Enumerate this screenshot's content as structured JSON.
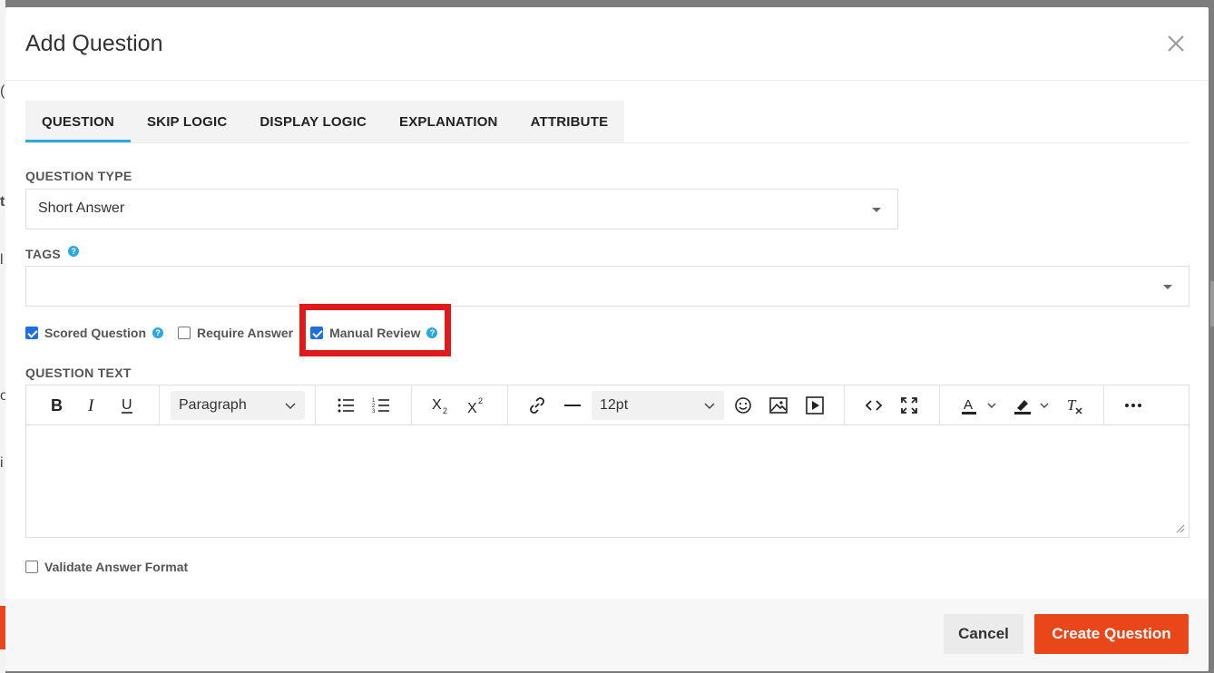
{
  "background": {
    "fragments": [
      "(U",
      "t",
      "l",
      "o",
      "i"
    ]
  },
  "modal": {
    "title": "Add Question",
    "tabs": [
      {
        "label": "QUESTION",
        "active": true
      },
      {
        "label": "SKIP LOGIC",
        "active": false
      },
      {
        "label": "DISPLAY LOGIC",
        "active": false
      },
      {
        "label": "EXPLANATION",
        "active": false
      },
      {
        "label": "ATTRIBUTE",
        "active": false
      }
    ],
    "question_type": {
      "label": "QUESTION TYPE",
      "value": "Short Answer"
    },
    "tags": {
      "label": "TAGS",
      "value": ""
    },
    "options": [
      {
        "label": "Scored Question",
        "checked": true,
        "help": true
      },
      {
        "label": "Require Answer",
        "checked": false,
        "help": false
      },
      {
        "label": "Manual Review",
        "checked": true,
        "help": true
      }
    ],
    "question_text": {
      "label": "QUESTION TEXT",
      "block_format": "Paragraph",
      "font_size": "12pt",
      "content": ""
    },
    "validate_answer_format": {
      "label": "Validate Answer Format",
      "checked": false
    },
    "buttons": {
      "cancel": "Cancel",
      "create": "Create Question"
    }
  },
  "colors": {
    "accent_blue": "#2aa8df",
    "checkbox_blue": "#1f6fe0",
    "primary_orange": "#e9461a",
    "highlight_red": "#e0191d"
  },
  "icons": [
    "close-icon",
    "bold-icon",
    "italic-icon",
    "underline-icon",
    "bullet-list-icon",
    "numbered-list-icon",
    "subscript-icon",
    "superscript-icon",
    "link-icon",
    "horizontal-rule-icon",
    "emoji-icon",
    "image-icon",
    "video-icon",
    "code-icon",
    "fullscreen-icon",
    "text-color-icon",
    "highlight-color-icon",
    "clear-format-icon",
    "more-icon",
    "help-icon"
  ]
}
